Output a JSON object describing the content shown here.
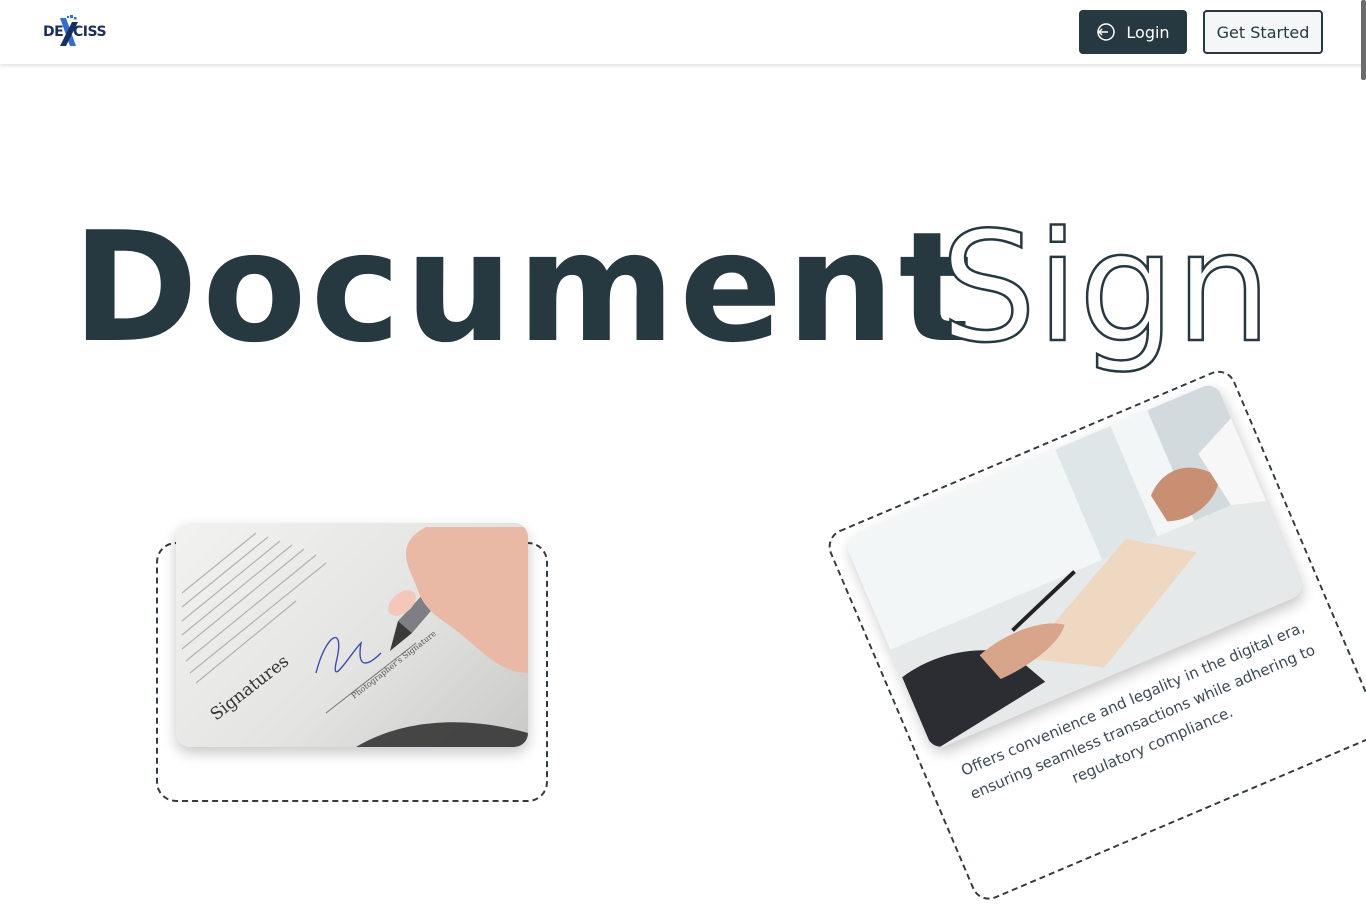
{
  "header": {
    "logo": {
      "text_left": "DE",
      "text_right": "CISS"
    },
    "login_label": "Login",
    "get_started_label": "Get Started"
  },
  "hero": {
    "title_solid": "Document",
    "title_outline": "Sign"
  },
  "cards": {
    "right_description": "Offers convenience and legality in the digital era, ensuring seamless transactions while adhering to regulatory compliance."
  },
  "photo_left": {
    "heading": "Signatures",
    "caption": "Photographer's Signature"
  },
  "colors": {
    "primary": "#263840",
    "button_secondary_bg": "#f4f6f7",
    "logo_blue": "#1b2f5e",
    "logo_accent": "#2f6fd6"
  }
}
